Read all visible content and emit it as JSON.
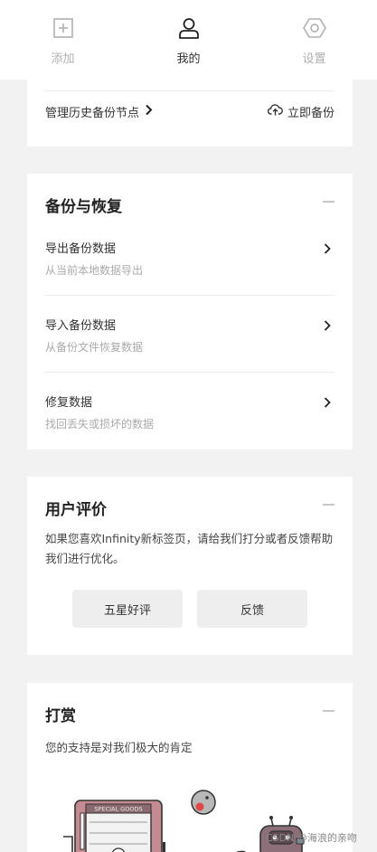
{
  "nav": {
    "items": [
      {
        "label": "添加",
        "icon": "plus-square-icon"
      },
      {
        "label": "我的",
        "icon": "user-icon"
      },
      {
        "label": "设置",
        "icon": "gear-hexagon-icon"
      }
    ],
    "active": "我的"
  },
  "backup_bar": {
    "manage_label": "管理历史备份节点",
    "backup_now_label": "立即备份"
  },
  "backup_section": {
    "title": "备份与恢复",
    "rows": [
      {
        "title": "导出备份数据",
        "subtitle": "从当前本地数据导出"
      },
      {
        "title": "导入备份数据",
        "subtitle": "从备份文件恢复数据"
      },
      {
        "title": "修复数据",
        "subtitle": "找回丢失或损坏的数据"
      }
    ]
  },
  "review_section": {
    "title": "用户评价",
    "text": "如果您喜欢Infinity新标签页，请给我们打分或者反馈帮助我们进行优化。",
    "buttons": {
      "five_star": "五星好评",
      "feedback": "反馈"
    }
  },
  "reward_section": {
    "title": "打赏",
    "subtitle": "您的支持是对我们极大的肯定",
    "illustration_sign": "SPECIAL GOODS"
  },
  "watermark": "CSDN @海浪的亲吻",
  "colors": {
    "background": "#f2f2f2",
    "card": "#ffffff",
    "text": "#333333",
    "muted": "#aaaaaa"
  }
}
